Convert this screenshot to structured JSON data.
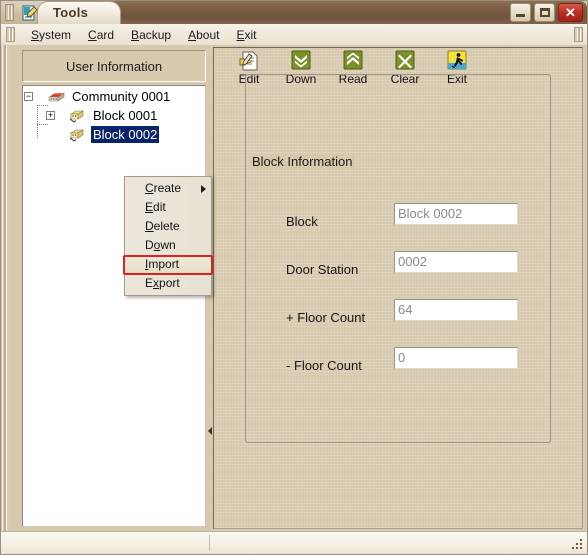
{
  "window": {
    "app_icon": "document-edit-icon",
    "title": "Tools",
    "buttons": {
      "minimize": "minimize-button",
      "maximize": "maximize-button",
      "close": "✕"
    }
  },
  "menubar": {
    "items": [
      {
        "label": "System",
        "accel": "S"
      },
      {
        "label": "Card",
        "accel": "C"
      },
      {
        "label": "Backup",
        "accel": "B"
      },
      {
        "label": "About",
        "accel": "A"
      },
      {
        "label": "Exit",
        "accel": "E"
      }
    ]
  },
  "left_panel": {
    "header": "User Information",
    "tree": {
      "nodes": [
        {
          "label": "Community 0001",
          "icon": "community-building-icon",
          "expander": "−",
          "indent": 0,
          "selected": false
        },
        {
          "label": "Block  0001",
          "icon": "block-building-icon",
          "expander": "+",
          "indent": 1,
          "selected": false
        },
        {
          "label": "Block  0002",
          "icon": "block-building-icon",
          "expander": "",
          "indent": 1,
          "selected": true
        }
      ]
    }
  },
  "context_menu": {
    "items": [
      {
        "label": "Create",
        "accel": "r",
        "has_submenu": true,
        "highlighted": false
      },
      {
        "label": "Edit",
        "accel": "E",
        "has_submenu": false,
        "highlighted": false
      },
      {
        "label": "Delete",
        "accel": "D",
        "has_submenu": false,
        "highlighted": false
      },
      {
        "label": "Down",
        "accel": "w",
        "has_submenu": false,
        "highlighted": false
      },
      {
        "label": "Import",
        "accel": "I",
        "has_submenu": false,
        "highlighted": true
      },
      {
        "label": "Export",
        "accel": "x",
        "has_submenu": false,
        "highlighted": false
      }
    ],
    "highlight_color": "#e02020"
  },
  "toolbar": {
    "buttons": [
      {
        "label": "Edit",
        "icon": "edit-document-icon"
      },
      {
        "label": "Down",
        "icon": "double-chevron-down-icon"
      },
      {
        "label": "Read",
        "icon": "double-chevron-up-icon"
      },
      {
        "label": "Clear",
        "icon": "cross-x-icon"
      },
      {
        "label": "Exit",
        "icon": "running-man-exit-icon"
      }
    ]
  },
  "block_information": {
    "group_title": "Block Information",
    "fields": [
      {
        "label": "Block",
        "value": "Block  0002",
        "name": "block-field"
      },
      {
        "label": "Door Station",
        "value": "0002",
        "name": "door-station-field"
      },
      {
        "label": "+ Floor Count",
        "value": "64",
        "name": "plus-floor-count-field"
      },
      {
        "label": "- Floor Count",
        "value": "0",
        "name": "minus-floor-count-field"
      }
    ]
  },
  "statusbar": {
    "left_text": "",
    "right_text": ""
  },
  "colors": {
    "window_background": "#d7c9ae",
    "titlebar_brown": "#7b5f45",
    "selection_blue": "#0a246a",
    "close_red": "#bf3327",
    "annotation_red": "#e02020"
  }
}
